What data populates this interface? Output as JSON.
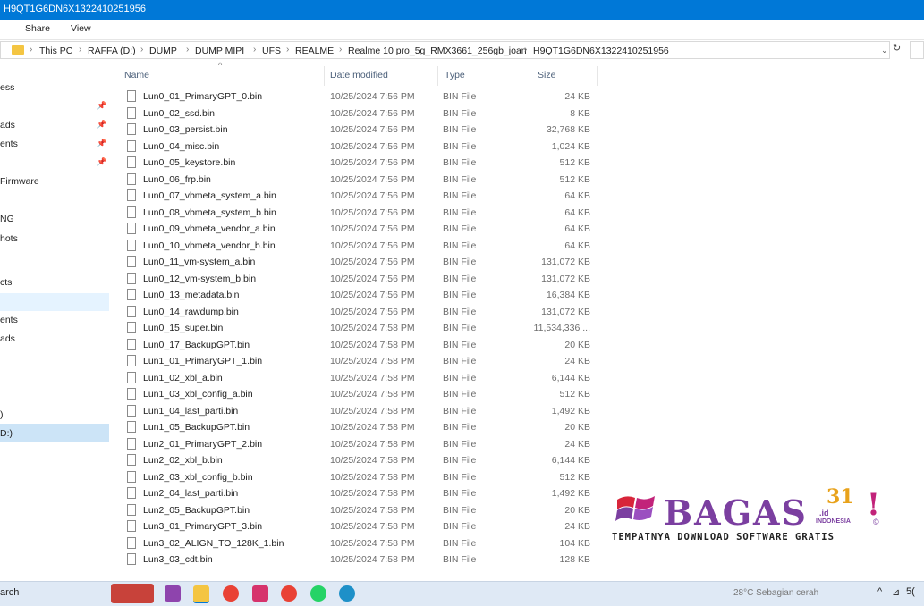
{
  "window": {
    "title": "H9QT1G6DN6X1322410251956"
  },
  "ribbon": {
    "tabs": [
      "Share",
      "View"
    ]
  },
  "address": {
    "crumbs": [
      "This PC",
      "RAFFA (D:)",
      "DUMP",
      "DUMP MIPI",
      "UFS",
      "REALME",
      "Realme 10 pro_5g_RMX3661_256gb_joan",
      "H9QT1G6DN6X1322410251956"
    ]
  },
  "nav": {
    "items": [
      "ess",
      "ads",
      "ents",
      "Firmware",
      "NG",
      "hots",
      "cts",
      "ents",
      "ads",
      ")",
      "D:)"
    ]
  },
  "columns": {
    "name": "Name",
    "date": "Date modified",
    "type": "Type",
    "size": "Size"
  },
  "files": [
    {
      "name": "Lun0_01_PrimaryGPT_0.bin",
      "date": "10/25/2024 7:56 PM",
      "type": "BIN File",
      "size": "24 KB"
    },
    {
      "name": "Lun0_02_ssd.bin",
      "date": "10/25/2024 7:56 PM",
      "type": "BIN File",
      "size": "8 KB"
    },
    {
      "name": "Lun0_03_persist.bin",
      "date": "10/25/2024 7:56 PM",
      "type": "BIN File",
      "size": "32,768 KB"
    },
    {
      "name": "Lun0_04_misc.bin",
      "date": "10/25/2024 7:56 PM",
      "type": "BIN File",
      "size": "1,024 KB"
    },
    {
      "name": "Lun0_05_keystore.bin",
      "date": "10/25/2024 7:56 PM",
      "type": "BIN File",
      "size": "512 KB"
    },
    {
      "name": "Lun0_06_frp.bin",
      "date": "10/25/2024 7:56 PM",
      "type": "BIN File",
      "size": "512 KB"
    },
    {
      "name": "Lun0_07_vbmeta_system_a.bin",
      "date": "10/25/2024 7:56 PM",
      "type": "BIN File",
      "size": "64 KB"
    },
    {
      "name": "Lun0_08_vbmeta_system_b.bin",
      "date": "10/25/2024 7:56 PM",
      "type": "BIN File",
      "size": "64 KB"
    },
    {
      "name": "Lun0_09_vbmeta_vendor_a.bin",
      "date": "10/25/2024 7:56 PM",
      "type": "BIN File",
      "size": "64 KB"
    },
    {
      "name": "Lun0_10_vbmeta_vendor_b.bin",
      "date": "10/25/2024 7:56 PM",
      "type": "BIN File",
      "size": "64 KB"
    },
    {
      "name": "Lun0_11_vm-system_a.bin",
      "date": "10/25/2024 7:56 PM",
      "type": "BIN File",
      "size": "131,072 KB"
    },
    {
      "name": "Lun0_12_vm-system_b.bin",
      "date": "10/25/2024 7:56 PM",
      "type": "BIN File",
      "size": "131,072 KB"
    },
    {
      "name": "Lun0_13_metadata.bin",
      "date": "10/25/2024 7:56 PM",
      "type": "BIN File",
      "size": "16,384 KB"
    },
    {
      "name": "Lun0_14_rawdump.bin",
      "date": "10/25/2024 7:56 PM",
      "type": "BIN File",
      "size": "131,072 KB"
    },
    {
      "name": "Lun0_15_super.bin",
      "date": "10/25/2024 7:58 PM",
      "type": "BIN File",
      "size": "11,534,336 ..."
    },
    {
      "name": "Lun0_17_BackupGPT.bin",
      "date": "10/25/2024 7:58 PM",
      "type": "BIN File",
      "size": "20 KB"
    },
    {
      "name": "Lun1_01_PrimaryGPT_1.bin",
      "date": "10/25/2024 7:58 PM",
      "type": "BIN File",
      "size": "24 KB"
    },
    {
      "name": "Lun1_02_xbl_a.bin",
      "date": "10/25/2024 7:58 PM",
      "type": "BIN File",
      "size": "6,144 KB"
    },
    {
      "name": "Lun1_03_xbl_config_a.bin",
      "date": "10/25/2024 7:58 PM",
      "type": "BIN File",
      "size": "512 KB"
    },
    {
      "name": "Lun1_04_last_parti.bin",
      "date": "10/25/2024 7:58 PM",
      "type": "BIN File",
      "size": "1,492 KB"
    },
    {
      "name": "Lun1_05_BackupGPT.bin",
      "date": "10/25/2024 7:58 PM",
      "type": "BIN File",
      "size": "20 KB"
    },
    {
      "name": "Lun2_01_PrimaryGPT_2.bin",
      "date": "10/25/2024 7:58 PM",
      "type": "BIN File",
      "size": "24 KB"
    },
    {
      "name": "Lun2_02_xbl_b.bin",
      "date": "10/25/2024 7:58 PM",
      "type": "BIN File",
      "size": "6,144 KB"
    },
    {
      "name": "Lun2_03_xbl_config_b.bin",
      "date": "10/25/2024 7:58 PM",
      "type": "BIN File",
      "size": "512 KB"
    },
    {
      "name": "Lun2_04_last_parti.bin",
      "date": "10/25/2024 7:58 PM",
      "type": "BIN File",
      "size": "1,492 KB"
    },
    {
      "name": "Lun2_05_BackupGPT.bin",
      "date": "10/25/2024 7:58 PM",
      "type": "BIN File",
      "size": "20 KB"
    },
    {
      "name": "Lun3_01_PrimaryGPT_3.bin",
      "date": "10/25/2024 7:58 PM",
      "type": "BIN File",
      "size": "24 KB"
    },
    {
      "name": "Lun3_02_ALIGN_TO_128K_1.bin",
      "date": "10/25/2024 7:58 PM",
      "type": "BIN File",
      "size": "104 KB"
    },
    {
      "name": "Lun3_03_cdt.bin",
      "date": "10/25/2024 7:58 PM",
      "type": "BIN File",
      "size": "128 KB"
    }
  ],
  "taskbar": {
    "search": "arch",
    "weather": "28°C  Sebagian cerah",
    "tray_time": "5("
  },
  "watermark": {
    "brand": "BAGAS",
    "number": "31",
    "domain": ".id",
    "country": "INDONESIA",
    "tagline": "TEMPATNYA DOWNLOAD SOFTWARE GRATIS"
  },
  "colors": {
    "titlebar": "#0078d7",
    "brand": "#7b3fa0",
    "accent": "#e8a21b"
  }
}
